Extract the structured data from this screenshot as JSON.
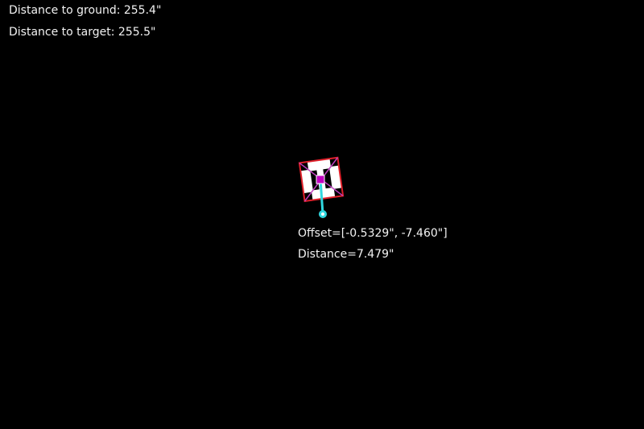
{
  "hud": {
    "distance_to_ground": "Distance to ground: 255.4\"",
    "distance_to_target": "Distance to target: 255.5\""
  },
  "target": {
    "offset_text": "Offset=[-0.5329\", -7.460\"]",
    "distance_text": "Distance=7.479\""
  },
  "colors": {
    "background": "#000000",
    "marker_outline": "#e0202a",
    "marker_cross": "#c040c0",
    "marker_center": "#c000c0",
    "offset_line": "#30d8e0"
  },
  "icons": {
    "fiducial_marker": "aruco-marker-icon",
    "target_point": "target-dot-icon"
  }
}
